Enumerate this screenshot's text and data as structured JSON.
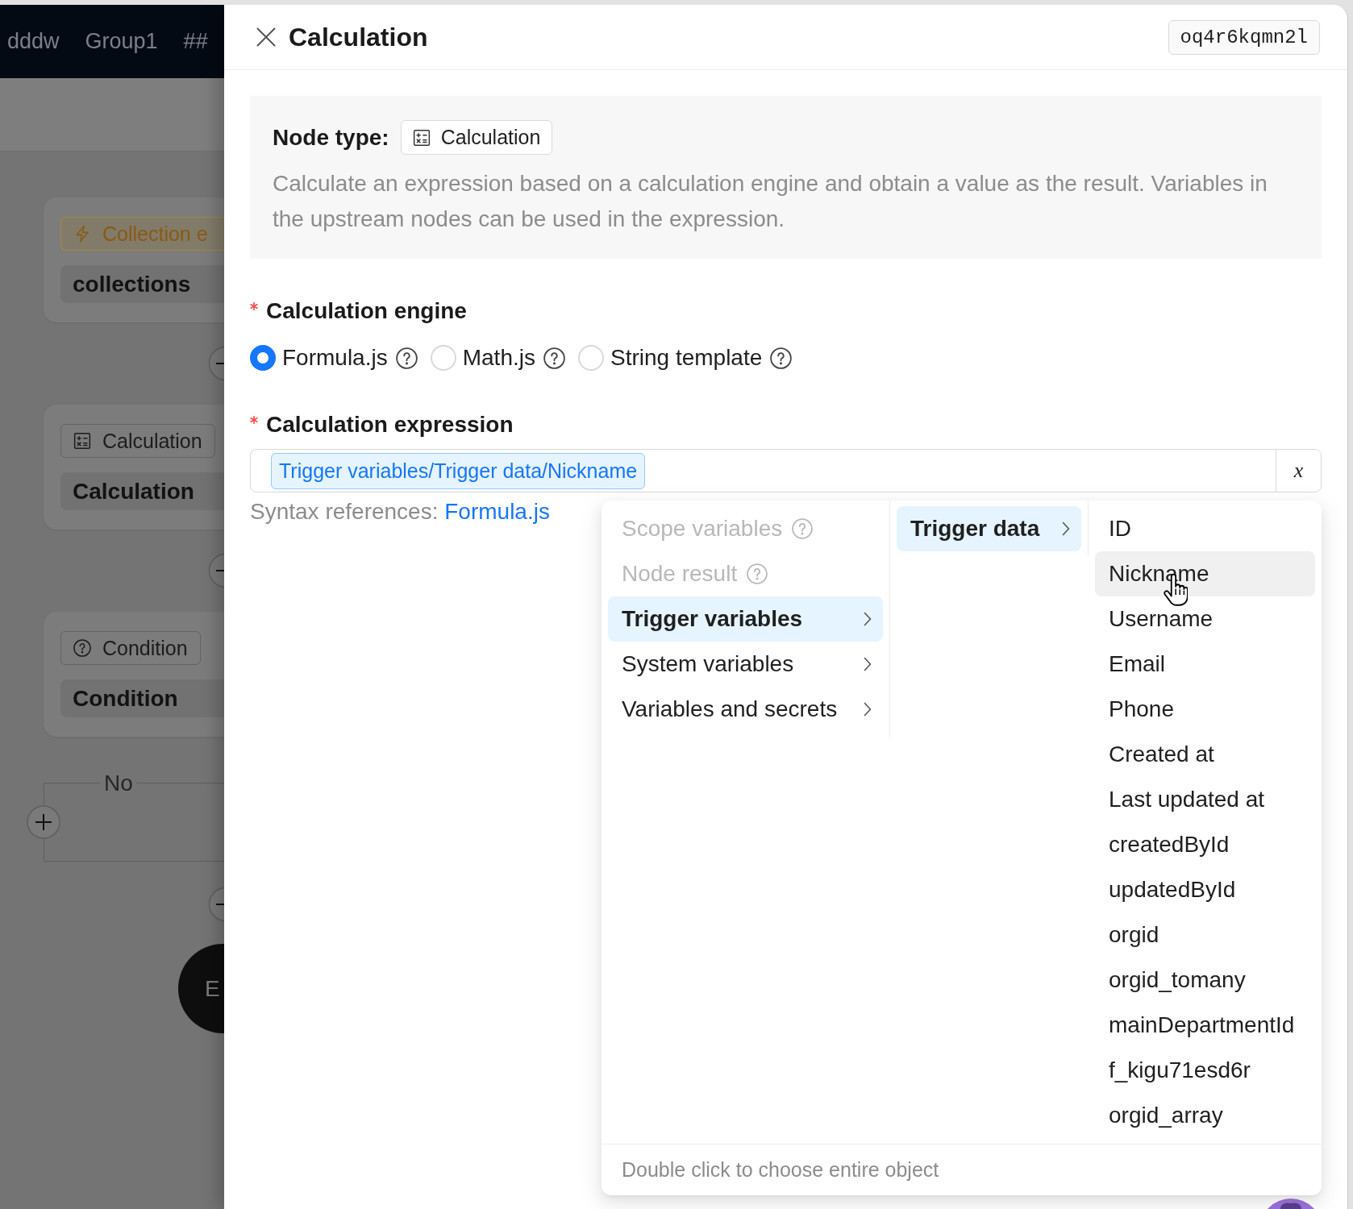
{
  "top_bar": {
    "items": [
      "dddw",
      "Group1",
      "##"
    ]
  },
  "canvas": {
    "nodes": [
      {
        "kind": "trigger",
        "tag": "Collection e",
        "title": "collections"
      },
      {
        "kind": "calculation",
        "tag": "Calculation",
        "title": "Calculation"
      },
      {
        "kind": "condition",
        "tag": "Condition",
        "title": "Condition"
      }
    ],
    "branch_label": "No",
    "end_node": "E"
  },
  "drawer": {
    "title": "Calculation",
    "node_id": "oq4r6kqmn2l",
    "node_type_label": "Node type:",
    "node_type": {
      "kind": "calculation",
      "label": "Calculation"
    },
    "description": "Calculate an expression based on a calculation engine and obtain a value as the result. Variables in the upstream nodes can be used in the expression."
  },
  "form": {
    "engine": {
      "label": "Calculation engine",
      "required": true,
      "options": [
        {
          "label": "Formula.js",
          "selected": true,
          "help": true
        },
        {
          "label": "Math.js",
          "selected": false,
          "help": true
        },
        {
          "label": "String template",
          "selected": false,
          "help": true
        }
      ]
    },
    "expression": {
      "label": "Calculation expression",
      "required": true,
      "value": "Trigger variables/Trigger data/Nickname",
      "variable_button": "x",
      "syntax_label": "Syntax references:",
      "syntax_link": "Formula.js"
    }
  },
  "variable_menu": {
    "columns": [
      {
        "items": [
          {
            "label": "Scope variables",
            "selected": false,
            "disabled": true,
            "help": true,
            "expandable": false
          },
          {
            "label": "Node result",
            "selected": false,
            "disabled": true,
            "help": true,
            "expandable": false
          },
          {
            "label": "Trigger variables",
            "selected": true,
            "disabled": false,
            "help": false,
            "expandable": true
          },
          {
            "label": "System variables",
            "selected": false,
            "disabled": false,
            "help": false,
            "expandable": true
          },
          {
            "label": "Variables and secrets",
            "selected": false,
            "disabled": false,
            "help": false,
            "expandable": true
          }
        ]
      },
      {
        "items": [
          {
            "label": "Trigger data",
            "selected": true,
            "expandable": true
          }
        ]
      },
      {
        "items": [
          {
            "label": "ID",
            "selected": false,
            "hovered": false
          },
          {
            "label": "Nickname",
            "selected": false,
            "hovered": true
          },
          {
            "label": "Username",
            "selected": false,
            "hovered": false
          },
          {
            "label": "Email",
            "selected": false,
            "hovered": false
          },
          {
            "label": "Phone",
            "selected": false,
            "hovered": false
          },
          {
            "label": "Created at",
            "selected": false,
            "hovered": false
          },
          {
            "label": "Last updated at",
            "selected": false,
            "hovered": false
          },
          {
            "label": "createdById",
            "selected": false,
            "hovered": false
          },
          {
            "label": "updatedById",
            "selected": false,
            "hovered": false
          },
          {
            "label": "orgid",
            "selected": false,
            "hovered": false
          },
          {
            "label": "orgid_tomany",
            "selected": false,
            "hovered": false
          },
          {
            "label": "mainDepartmentId",
            "selected": false,
            "hovered": false
          },
          {
            "label": "f_kigu71esd6r",
            "selected": false,
            "hovered": false
          },
          {
            "label": "orgid_array",
            "selected": false,
            "hovered": false
          }
        ]
      }
    ],
    "footer": "Double click to choose entire object"
  }
}
